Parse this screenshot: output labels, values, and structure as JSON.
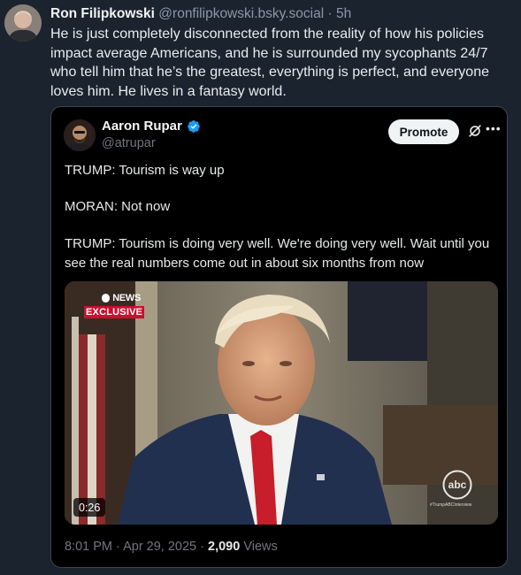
{
  "post": {
    "author": "Ron Filipkowski",
    "handle": "@ronfilipkowski.bsky.social",
    "separator": "·",
    "age": "5h",
    "text": "He is just completely disconnected from the reality of how his policies impact average Americans, and he is surrounded my sycophants 24/7 who tell him that he’s the greatest, everything is perfect, and everyone loves him. He lives in a fantasy world."
  },
  "quote": {
    "author": "Aaron Rupar",
    "handle": "@atrupar",
    "verified_color": "#1d9bf0",
    "promote_label": "Promote",
    "paragraphs": [
      "TRUMP: Tourism is way up",
      "MORAN: Not now",
      "TRUMP: Tourism is doing very well. We're doing very well. Wait until you see the real numbers come out in about six months from now"
    ],
    "video": {
      "network_logo": "NEWS",
      "badge": "EXCLUSIVE",
      "duration": "0:26",
      "corner_logo": "abc",
      "corner_caption": "#TrumpABCInterview"
    },
    "timestamp": "8:01 PM · Apr 29, 2025 ·",
    "views_count": "2,090",
    "views_label": "Views"
  },
  "icons": {
    "verified": "verified-badge-icon",
    "grok": "grok-icon",
    "more": "more-icon"
  }
}
